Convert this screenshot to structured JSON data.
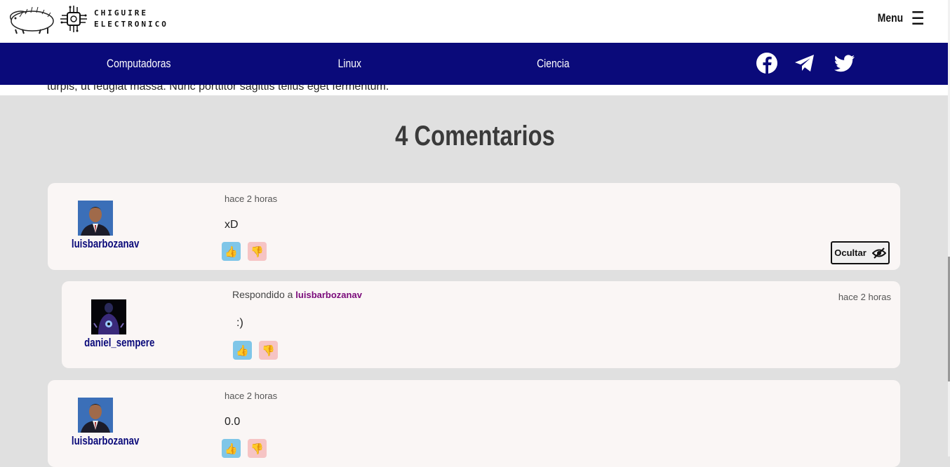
{
  "header": {
    "logo_line1": "CHIGUIRE",
    "logo_line2": "ELECTRONICO",
    "menu_label": "Menu"
  },
  "nav": {
    "items": [
      "Computadoras",
      "Linux",
      "Ciencia"
    ],
    "social": [
      "facebook-icon",
      "telegram-icon",
      "twitter-icon"
    ]
  },
  "article": {
    "tail_text": "turpis, ut feugiat massa. Nunc porttitor sagittis tellus eget fermentum."
  },
  "comments_section": {
    "title": "4 Comentarios",
    "comments": [
      {
        "user": "luisbarbozanav",
        "time": "hace 2 horas",
        "text": "xD",
        "hide_label": "Ocultar"
      },
      {
        "user": "daniel_sempere",
        "time": "hace 2 horas",
        "text": ":)",
        "reply_prefix": "Respondido a",
        "reply_to": "luisbarbozanav"
      },
      {
        "user": "luisbarbozanav",
        "time": "hace 2 horas",
        "text": "0.0"
      }
    ]
  },
  "colors": {
    "nav_bg": "#0a0a7a",
    "page_bg": "#e0e0e0",
    "card_bg": "#faf6f5",
    "username": "#0a0a7a",
    "reply_link": "#7a0a7a"
  }
}
